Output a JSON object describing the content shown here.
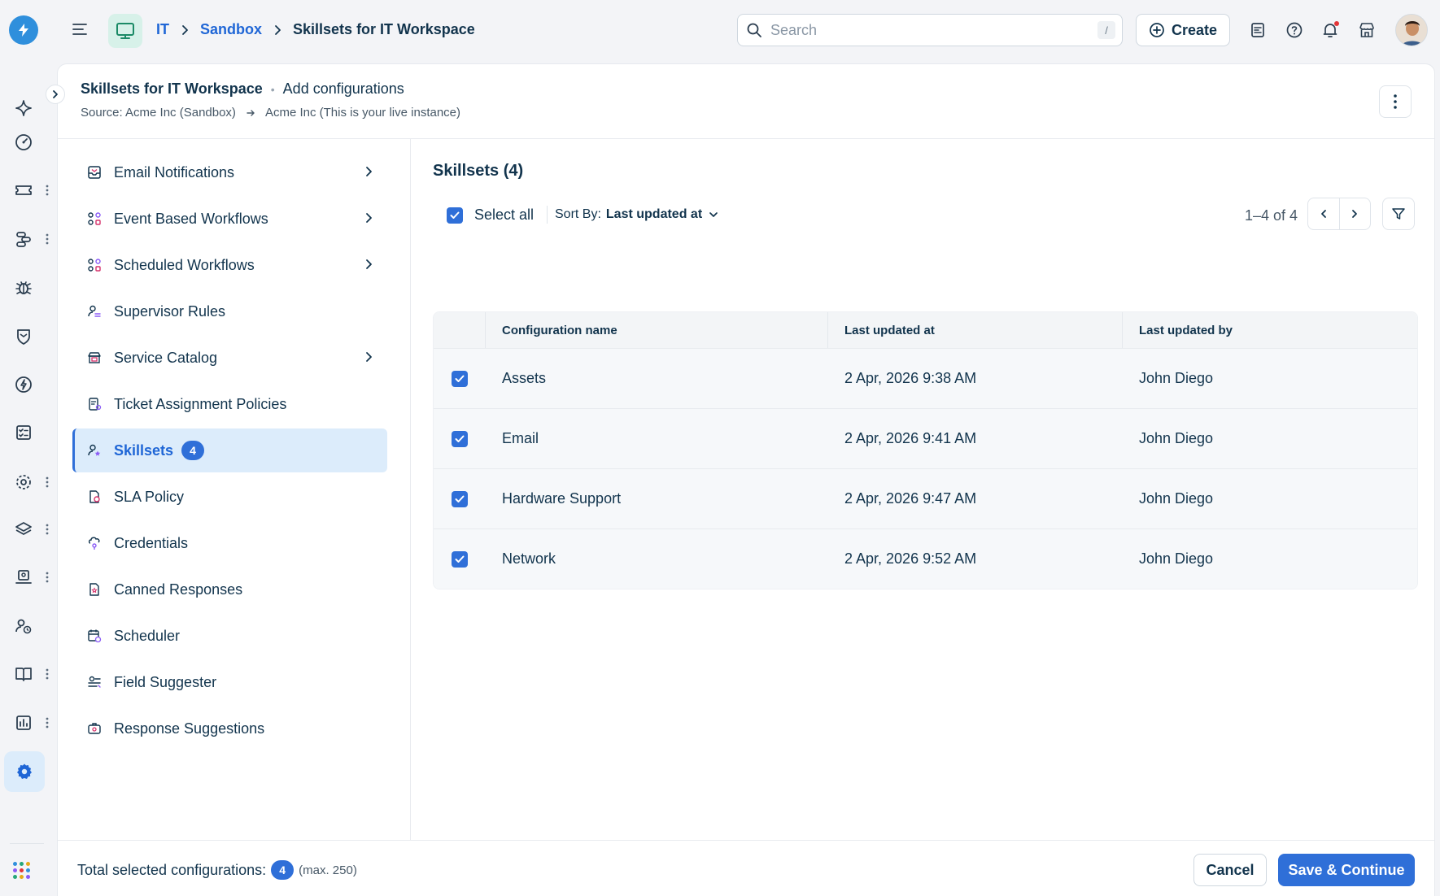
{
  "header": {
    "breadcrumbs": [
      "IT",
      "Sandbox",
      "Skillsets for IT Workspace"
    ],
    "search": {
      "placeholder": "Search",
      "shortcut": "/"
    },
    "create_label": "Create",
    "icons": [
      "menu-icon",
      "workspace-monitor-icon",
      "search-icon",
      "plus-circle-icon",
      "contact-card-icon",
      "help-icon",
      "bell-icon",
      "store-icon"
    ]
  },
  "page": {
    "title": "Skillsets for IT Workspace",
    "subtitle": "Add configurations",
    "source": "Source: Acme Inc (Sandbox)",
    "target": "Acme Inc (This is your live instance)"
  },
  "menu": {
    "items": [
      {
        "label": "Email Notifications",
        "icon": "email-inbox-icon",
        "chevron": true,
        "active": false
      },
      {
        "label": "Event Based Workflows",
        "icon": "workflow-icon",
        "chevron": true,
        "active": false
      },
      {
        "label": "Scheduled Workflows",
        "icon": "workflow-icon",
        "chevron": true,
        "active": false
      },
      {
        "label": "Supervisor Rules",
        "icon": "supervisor-icon",
        "chevron": false,
        "active": false
      },
      {
        "label": "Service Catalog",
        "icon": "catalog-icon",
        "chevron": true,
        "active": false
      },
      {
        "label": "Ticket Assignment Policies",
        "icon": "assignment-policy-icon",
        "chevron": false,
        "active": false
      },
      {
        "label": "Skillsets",
        "icon": "skillset-icon",
        "chevron": false,
        "active": true,
        "badge": "4"
      },
      {
        "label": "SLA Policy",
        "icon": "sla-policy-icon",
        "chevron": false,
        "active": false
      },
      {
        "label": "Credentials",
        "icon": "credentials-icon",
        "chevron": false,
        "active": false
      },
      {
        "label": "Canned Responses",
        "icon": "canned-response-icon",
        "chevron": false,
        "active": false
      },
      {
        "label": "Scheduler",
        "icon": "calendar-clock-icon",
        "chevron": false,
        "active": false
      },
      {
        "label": "Field Suggester",
        "icon": "field-suggester-icon",
        "chevron": false,
        "active": false
      },
      {
        "label": "Response Suggestions",
        "icon": "response-suggestion-icon",
        "chevron": false,
        "active": false
      }
    ]
  },
  "content": {
    "title": "Skillsets (4)",
    "select_all_label": "Select all",
    "sort_label": "Sort By:",
    "sort_value": "Last updated at",
    "pagination": "1–4 of 4",
    "table": {
      "columns": [
        "Configuration name",
        "Last updated at",
        "Last updated by"
      ],
      "rows": [
        {
          "name": "Assets",
          "updated_at": "2 Apr, 2026 9:38 AM",
          "updated_by": "John Diego",
          "checked": true
        },
        {
          "name": "Email",
          "updated_at": "2 Apr, 2026 9:41 AM",
          "updated_by": "John Diego",
          "checked": true
        },
        {
          "name": "Hardware Support",
          "updated_at": "2 Apr, 2026 9:47 AM",
          "updated_by": "John Diego",
          "checked": true
        },
        {
          "name": "Network",
          "updated_at": "2 Apr, 2026 9:52 AM",
          "updated_by": "John Diego",
          "checked": true
        }
      ]
    }
  },
  "footer": {
    "total_label": "Total selected configurations:",
    "total_count": "4",
    "max_label": "(max. 250)",
    "cancel_label": "Cancel",
    "save_label": "Save & Continue"
  },
  "colors": {
    "accent": "#2f6fd8",
    "active_bg": "#dcecfb",
    "logo": "#2f8fdc",
    "workspace_icon_bg": "#d7f1e9"
  },
  "rail": {
    "icons": [
      "freddy-ai-icon",
      "dashboard-gauge-icon",
      "ticket-icon",
      "service-flow-icon",
      "bug-icon",
      "shield-icon",
      "change-icon",
      "checklist-icon",
      "settings-gear-group-icon",
      "layers-icon",
      "laptop-user-icon",
      "user-clock-icon",
      "book-icon",
      "analytics-icon",
      "admin-gear-icon",
      "apps-grid-icon"
    ]
  }
}
